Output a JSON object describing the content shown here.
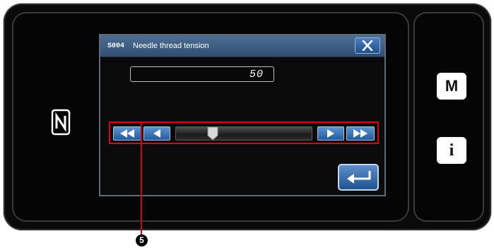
{
  "dialog": {
    "code": "S004",
    "title": "Needle thread tension",
    "value": "50",
    "close_icon": "close-x-icon"
  },
  "slider": {
    "level_fraction": 0.25,
    "buttons": [
      "fast-rewind-icon",
      "step-left-icon",
      "step-right-icon",
      "fast-forward-icon"
    ]
  },
  "enter": {
    "icon": "enter-return-icon"
  },
  "side_panel": {
    "m_label": "M",
    "info_label": "i"
  },
  "annotation": {
    "callout_number": "5"
  },
  "colors": {
    "button_blue": "#2d63a6",
    "title_bar": "#3b5c84",
    "callout_red": "#d30019"
  }
}
